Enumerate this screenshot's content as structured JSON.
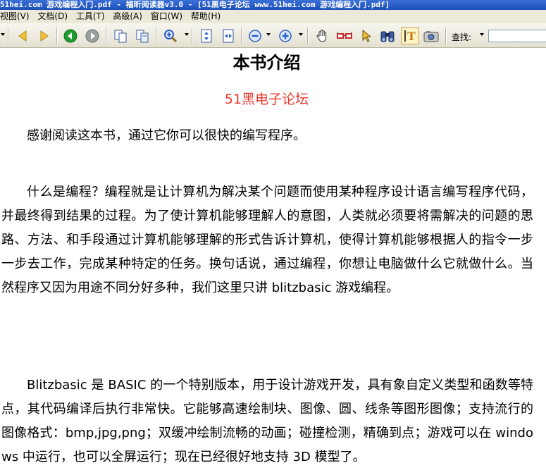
{
  "window": {
    "title": "51hei.com 游戏编程入门.pdf - 福昕阅读器v3.0 - [51黑电子论坛 www.51hei.com 游戏编程入门.pdf]"
  },
  "menu": {
    "items": [
      "视图(V)",
      "文档(D)",
      "工具(T)",
      "高级(A)",
      "窗口(W)",
      "帮助(H)"
    ]
  },
  "toolbar": {
    "find_label": "查找:",
    "find_value": ""
  },
  "icons": {
    "back": "arrow-left-icon",
    "forward": "arrow-right-icon",
    "prev": "green-back-icon",
    "next": "green-forward-icon",
    "copy": "copy-page-icon",
    "zoom": "zoom-icon",
    "fit_page": "fit-page-icon",
    "fit_width": "fit-width-icon",
    "zoom_out": "zoom-out-icon",
    "zoom_in": "zoom-in-icon",
    "hand": "hand-icon",
    "glasses": "glasses-icon",
    "select": "arrow-select-icon",
    "binoculars": "binoculars-icon",
    "text_select": "text-select-icon",
    "snapshot": "camera-icon"
  },
  "colors": {
    "subtitle": "#e8382c",
    "accent_blue": "#2a5fc8",
    "green_nav": "#1f9c2e"
  },
  "document": {
    "title": "本书介绍",
    "subtitle": "51黑电子论坛",
    "paragraphs": [
      "感谢阅读这本书，通过它你可以很快的编写程序。",
      "什么是编程？编程就是让计算机为解决某个问题而使用某种程序设计语言编写程序代码，并最终得到结果的过程。为了使计算机能够理解人的意图，人类就必须要将需解决的问题的思路、方法、和手段通过计算机能够理解的形式告诉计算机，使得计算机能够根据人的指令一步一步去工作，完成某种特定的任务。换句话说，通过编程，你想让电脑做什么它就做什么。当然程序又因为用途不同分好多种，我们这里只讲 blitzbasic 游戏编程。",
      "Blitzbasic 是 BASIC 的一个特别版本，用于设计游戏开发，具有象自定义类型和函数等特点，其代码编译后执行非常快。它能够高速绘制块、图像、圆、线条等图形图像；支持流行的图像格式：bmp,jpg,png；双缓冲绘制流畅的动画；碰撞检测，精确到点；游戏可以在 windows 中运行，也可以全屏运行；现在已经很好地支持 3D 模型了。"
    ]
  }
}
